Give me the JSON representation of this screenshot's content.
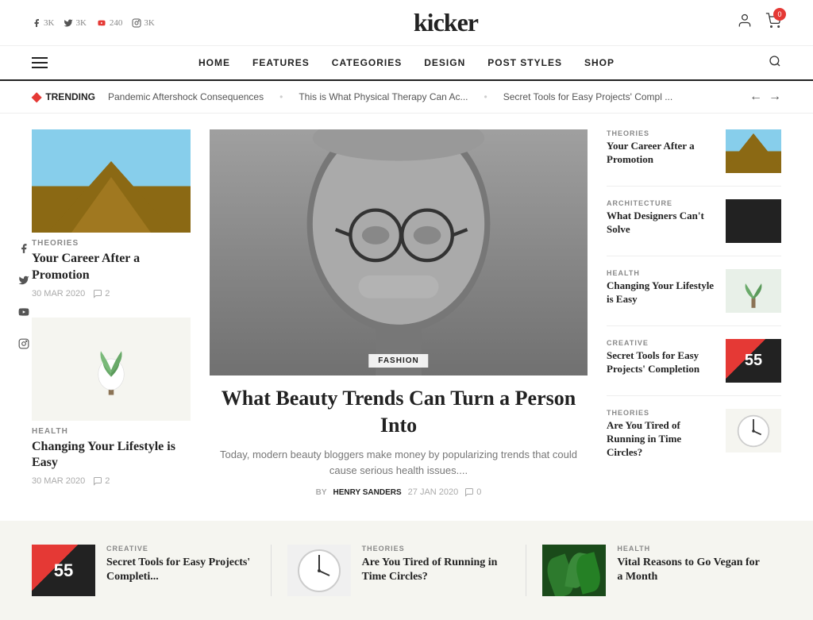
{
  "site": {
    "logo": "kicker"
  },
  "topbar": {
    "social": [
      {
        "icon": "facebook",
        "label": "f",
        "count": "3K"
      },
      {
        "icon": "twitter",
        "label": "t",
        "count": "3K"
      },
      {
        "icon": "youtube",
        "label": "▶",
        "count": "240"
      },
      {
        "icon": "instagram",
        "label": "◎",
        "count": "3K"
      }
    ],
    "cart_count": "0"
  },
  "nav": {
    "menu_icon": "≡",
    "links": [
      "HOME",
      "FEATURES",
      "CATEGORIES",
      "DESIGN",
      "POST STYLES",
      "SHOP"
    ],
    "search_icon": "🔍"
  },
  "trending": {
    "label": "TRENDING",
    "items": [
      "Pandemic Aftershock Consequences",
      "This is What Physical Therapy Can Ac...",
      "Secret Tools for Easy Projects' Compl ..."
    ]
  },
  "left_articles": [
    {
      "category": "THEORIES",
      "title": "Your Career After a Promotion",
      "date": "30 MAR 2020",
      "comments": "2",
      "image_type": "arch"
    },
    {
      "category": "HEALTH",
      "title": "Changing Your Lifestyle is Easy",
      "date": "30 MAR 2020",
      "comments": "2",
      "image_type": "plant"
    }
  ],
  "featured": {
    "tag": "FASHION",
    "title": "What Beauty Trends Can Turn a Person Into",
    "excerpt": "Today, modern beauty bloggers make money by popularizing trends that could cause serious health issues....",
    "by": "BY",
    "author": "HENRY SANDERS",
    "date": "27 JAN 2020",
    "comments": "0"
  },
  "right_articles": [
    {
      "category": "THEORIES",
      "title": "Your Career After a Promotion",
      "image_type": "arch"
    },
    {
      "category": "ARCHITECTURE",
      "title": "What Designers Can't Solve",
      "image_type": "dark"
    },
    {
      "category": "HEALTH",
      "title": "Changing Your Lifestyle is Easy",
      "image_type": "plant2"
    },
    {
      "category": "CREATIVE",
      "title": "Secret Tools for Easy Projects' Completion",
      "image_type": "scissors"
    },
    {
      "category": "THEORIES",
      "title": "Are You Tired of Running in Time Circles?",
      "image_type": "clock"
    }
  ],
  "social_sidebar": [
    {
      "icon": "f",
      "name": "facebook"
    },
    {
      "icon": "t",
      "name": "twitter"
    },
    {
      "icon": "▶",
      "name": "youtube"
    },
    {
      "icon": "◎",
      "name": "instagram"
    }
  ],
  "bottom_articles": [
    {
      "category": "CREATIVE",
      "title": "Secret Tools for Easy Projects' Completi...",
      "image_type": "scissors2"
    },
    {
      "category": "THEORIES",
      "title": "Are You Tired of Running in Time Circles?",
      "image_type": "clock2"
    },
    {
      "category": "HEALTH",
      "title": "Vital Reasons to Go Vegan for a Month",
      "image_type": "leaves2"
    }
  ]
}
